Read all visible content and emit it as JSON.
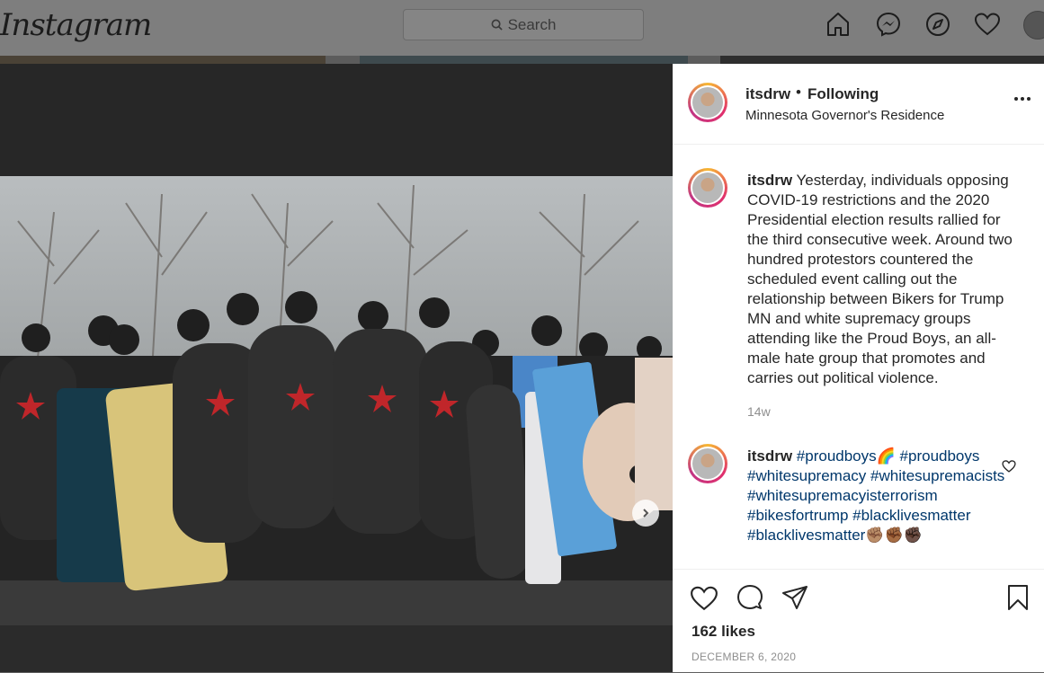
{
  "nav": {
    "logo": "Instagram",
    "search_placeholder": "Search",
    "icons": [
      "home-icon",
      "messenger-icon",
      "explore-icon",
      "activity-heart-icon",
      "profile-avatar"
    ]
  },
  "post": {
    "username": "itsdrw",
    "separator": "•",
    "follow_status": "Following",
    "location": "Minnesota Governor's Residence",
    "caption": {
      "username": "itsdrw",
      "text": "Yesterday, individuals opposing COVID-19 restrictions and the 2020 Presidential election results rallied for the third consecutive week. Around two hundred protestors countered the scheduled event calling out the relationship between Bikers for Trump MN and white supremacy groups attending like the Proud Boys, an all-male hate group that promotes and carries out political violence.",
      "time_ago": "14w"
    },
    "comment": {
      "username": "itsdrw",
      "hashtags": [
        "#proudboys🌈",
        "#proudboys",
        "#whitesupremacy",
        "#whitesupremacists",
        "#whitesupremacyisterrorism",
        "#bikesfortrump",
        "#blacklivesmatter",
        "#blacklivesmatter✊🏽✊🏾✊🏿"
      ]
    },
    "likes": "162 likes",
    "date": "DECEMBER 6, 2020"
  },
  "colors": {
    "overlay_dim": "#7e7e7e",
    "text_primary": "#262626",
    "text_secondary": "#8e8e8e",
    "hashtag": "#00376b"
  }
}
